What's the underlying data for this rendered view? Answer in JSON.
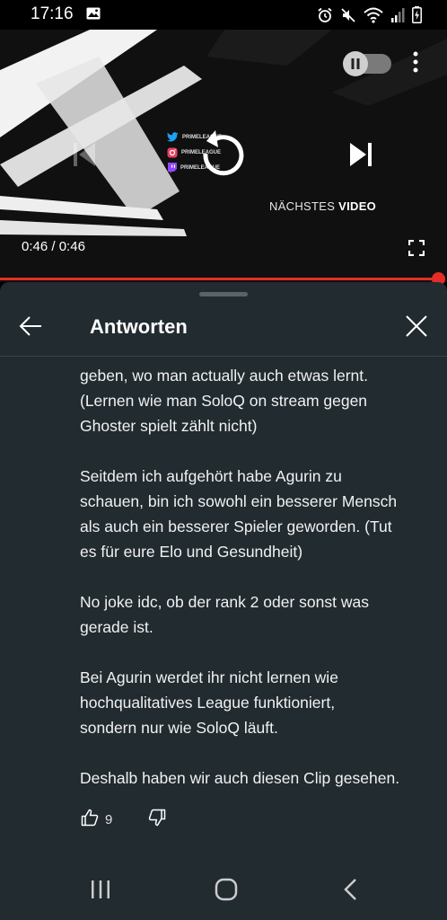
{
  "status_bar": {
    "time": "17:16",
    "icons": [
      "image-icon",
      "alarm-icon",
      "mute-icon",
      "wifi-icon",
      "signal-icon",
      "battery-charging-icon"
    ]
  },
  "player": {
    "social_handles": [
      "PRIMELEAGUE",
      "PRIMELEAGUE",
      "PRIMELEAGUE"
    ],
    "next_label_light": "NÄCHSTES",
    "next_label_bold": "VIDEO",
    "time_current": "0:46",
    "time_separator": " / ",
    "time_total": "0:46",
    "progress": 1.0,
    "accent_color": "#e52d27"
  },
  "panel": {
    "title": "Antworten",
    "comment_paragraphs": [
      "geben, wo man actually auch etwas lernt.\n(Lernen wie man SoloQ on stream gegen\nGhoster spielt zählt nicht)",
      "Seitdem ich aufgehört habe Agurin zu\nschauen, bin ich sowohl ein besserer Mensch\nals auch ein besserer Spieler geworden. (Tut\nes für eure Elo und Gesundheit)",
      "No joke idc, ob der rank 2 oder sonst was\ngerade ist.",
      "Bei Agurin werdet ihr nicht lernen wie\nhochqualitatives League funktioniert,\nsondern nur wie SoloQ läuft.",
      "Deshalb haben wir auch diesen Clip gesehen."
    ],
    "like_count": "9"
  },
  "colors": {
    "panel_bg": "#212b30",
    "accent": "#e52d27"
  }
}
